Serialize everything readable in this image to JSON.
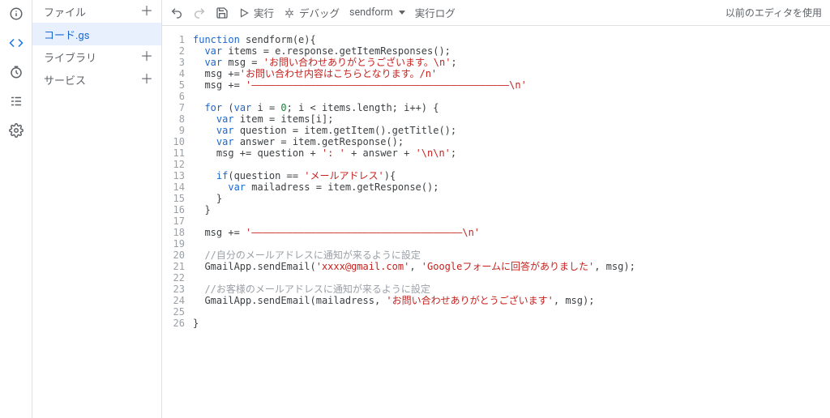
{
  "rail": {
    "info_icon": "info-icon",
    "editor_icon": "code-icon",
    "triggers_icon": "clock-icon",
    "executions_icon": "list-icon",
    "settings_icon": "gear-icon"
  },
  "filepanel": {
    "files_label": "ファイル",
    "libraries_label": "ライブラリ",
    "services_label": "サービス",
    "plus_glyph": "＋",
    "active_file": "コード.gs"
  },
  "toolbar": {
    "undo_title": "Undo",
    "redo_title": "Redo",
    "save_title": "Save",
    "run_label": "実行",
    "debug_label": "デバッグ",
    "func_selector": "sendform",
    "log_label": "実行ログ",
    "legacy_label": "以前のエディタを使用"
  },
  "code": {
    "lines": [
      [
        [
          "kw",
          "function"
        ],
        [
          "id",
          " sendform(e){"
        ]
      ],
      [
        [
          "id",
          "  "
        ],
        [
          "kw",
          "var"
        ],
        [
          "id",
          " items = e.response.getItemResponses();"
        ]
      ],
      [
        [
          "id",
          "  "
        ],
        [
          "kw",
          "var"
        ],
        [
          "id",
          " msg = "
        ],
        [
          "str",
          "'お問い合わせありがとうございます。\\n'"
        ],
        [
          "id",
          ";"
        ]
      ],
      [
        [
          "id",
          "  msg +="
        ],
        [
          "str",
          "'お問い合わせ内容はこちらとなります。/n'"
        ]
      ],
      [
        [
          "id",
          "  msg += "
        ],
        [
          "str",
          "'————————————————————————————————————————————\\n'"
        ]
      ],
      [
        [
          "id",
          ""
        ]
      ],
      [
        [
          "id",
          "  "
        ],
        [
          "kw",
          "for"
        ],
        [
          "id",
          " ("
        ],
        [
          "kw",
          "var"
        ],
        [
          "id",
          " i = "
        ],
        [
          "num",
          "0"
        ],
        [
          "id",
          "; i < items.length; i++) {"
        ]
      ],
      [
        [
          "id",
          "    "
        ],
        [
          "kw",
          "var"
        ],
        [
          "id",
          " item = items[i];"
        ]
      ],
      [
        [
          "id",
          "    "
        ],
        [
          "kw",
          "var"
        ],
        [
          "id",
          " question = item.getItem().getTitle();"
        ]
      ],
      [
        [
          "id",
          "    "
        ],
        [
          "kw",
          "var"
        ],
        [
          "id",
          " answer = item.getResponse();"
        ]
      ],
      [
        [
          "id",
          "    msg += question + "
        ],
        [
          "str",
          "': '"
        ],
        [
          "id",
          " + answer + "
        ],
        [
          "str",
          "'\\n\\n'"
        ],
        [
          "id",
          ";"
        ]
      ],
      [
        [
          "id",
          ""
        ]
      ],
      [
        [
          "id",
          "    "
        ],
        [
          "kw",
          "if"
        ],
        [
          "id",
          "(question == "
        ],
        [
          "str",
          "'メールアドレス'"
        ],
        [
          "id",
          "){"
        ]
      ],
      [
        [
          "id",
          "      "
        ],
        [
          "kw",
          "var"
        ],
        [
          "id",
          " mailadress = item.getResponse();"
        ]
      ],
      [
        [
          "id",
          "    }"
        ]
      ],
      [
        [
          "id",
          "  }"
        ]
      ],
      [
        [
          "id",
          ""
        ]
      ],
      [
        [
          "id",
          "  msg += "
        ],
        [
          "str",
          "'————————————————————————————————————\\n'"
        ]
      ],
      [
        [
          "id",
          ""
        ]
      ],
      [
        [
          "id",
          "  "
        ],
        [
          "com",
          "//自分のメールアドレスに通知が来るように設定"
        ]
      ],
      [
        [
          "id",
          "  GmailApp.sendEmail("
        ],
        [
          "str",
          "'xxxx@gmail.com'"
        ],
        [
          "id",
          ", "
        ],
        [
          "str",
          "'Googleフォームに回答がありました'"
        ],
        [
          "id",
          ", msg);"
        ]
      ],
      [
        [
          "id",
          ""
        ]
      ],
      [
        [
          "id",
          "  "
        ],
        [
          "com",
          "//お客様のメールアドレスに通知が来るように設定"
        ]
      ],
      [
        [
          "id",
          "  GmailApp.sendEmail(mailadress, "
        ],
        [
          "str",
          "'お問い合わせありがとうございます'"
        ],
        [
          "id",
          ", msg);"
        ]
      ],
      [
        [
          "id",
          ""
        ]
      ],
      [
        [
          "id",
          "}"
        ]
      ]
    ]
  }
}
